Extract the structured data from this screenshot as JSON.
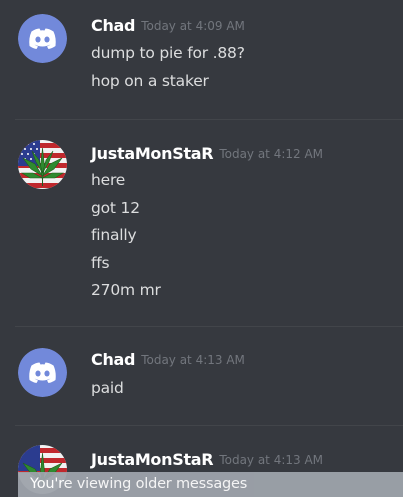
{
  "messages": [
    {
      "author": "Chad",
      "time": "Today at 4:09 AM",
      "avatar": "discord-default-avatar",
      "lines": [
        "dump to pie for .88?",
        "hop on a staker"
      ]
    },
    {
      "author": "JustaMonStaR",
      "time": "Today at 4:12 AM",
      "avatar": "flag-leaf-avatar",
      "lines": [
        "here",
        "got 12",
        "finally",
        "ffs",
        "270m mr"
      ]
    },
    {
      "author": "Chad",
      "time": "Today at 4:13 AM",
      "avatar": "discord-default-avatar",
      "lines": [
        "paid"
      ]
    },
    {
      "author": "JustaMonStaR",
      "time": "Today at 4:13 AM",
      "avatar": "flag-leaf-avatar",
      "lines": []
    }
  ],
  "older_messages_bar": {
    "text": "You're viewing older messages"
  },
  "colors": {
    "background": "#36393f",
    "discord_blurple": "#7289da",
    "username": "#ffffff",
    "timestamp": "#72767d",
    "message_text": "#dcddde",
    "older_bar": "#9ea3ab"
  }
}
